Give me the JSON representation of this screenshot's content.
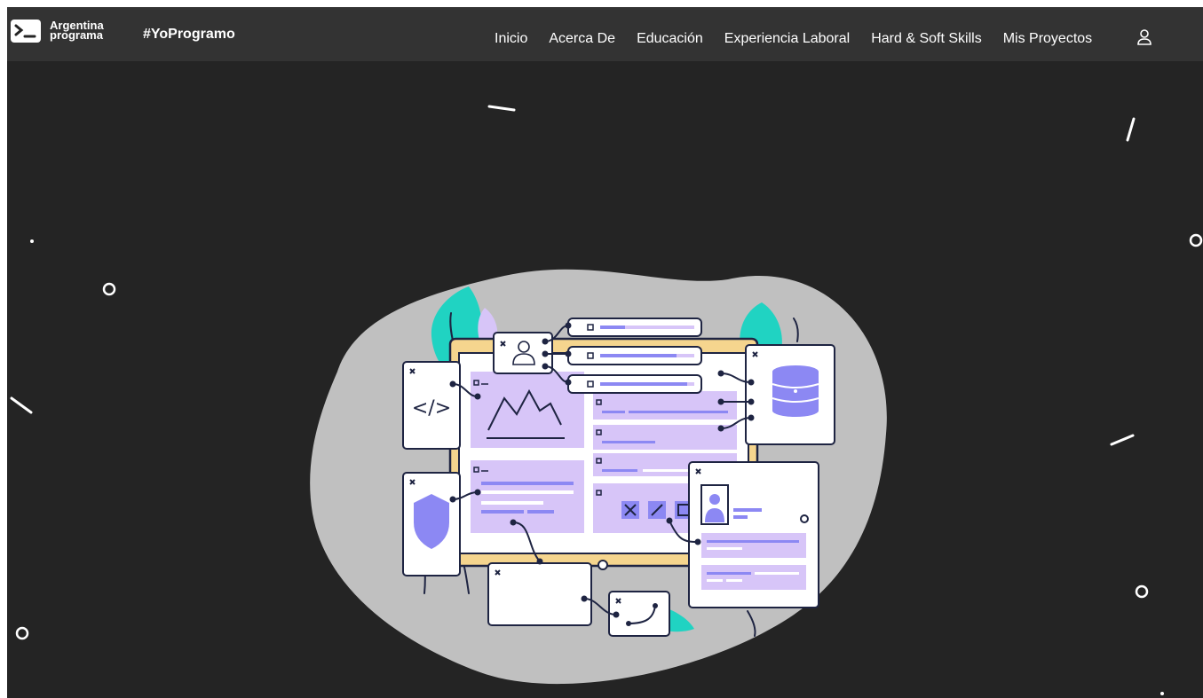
{
  "brand": {
    "logo_line1": "Argentina",
    "logo_line2": "programa",
    "tagline": "#YoProgramo"
  },
  "nav": {
    "items": [
      "Inicio",
      "Acerca De",
      "Educación",
      "Experiencia Laboral",
      "Hard & Soft Skills",
      "Mis Proyectos"
    ],
    "user_icon": "user-icon"
  },
  "hero": {
    "illustration": "web-development-illustration"
  },
  "colors": {
    "background": "#242424",
    "navbar": "#333333",
    "lavender": "#D7C5F8",
    "purple": "#8C88F3",
    "teal": "#20D3C2",
    "yellow": "#F5D58E",
    "blob": "#C0C0C0",
    "stroke": "#1E2442"
  }
}
